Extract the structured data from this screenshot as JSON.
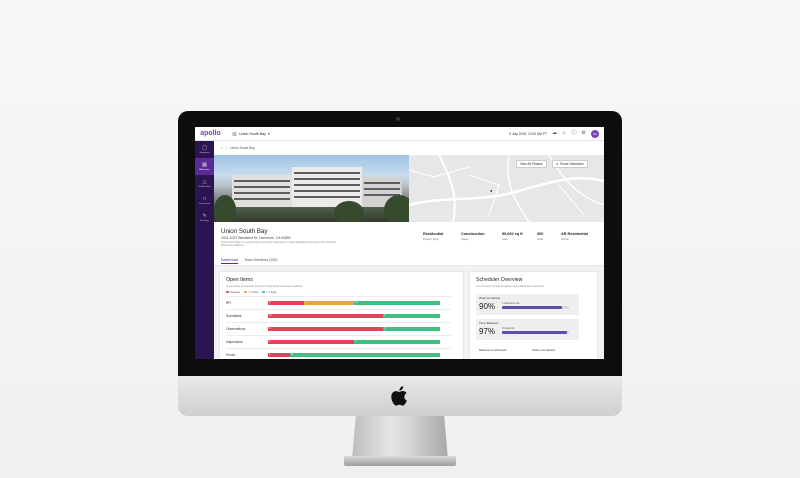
{
  "app": {
    "brand": "apollo",
    "project_selector": "Union South Bay",
    "date": "9 July 2019, 10:00 AM PT",
    "user_initials": "AF"
  },
  "sidebar": {
    "items": [
      {
        "label": "Budgeting",
        "icon": "dollar-icon",
        "active": false
      },
      {
        "label": "Milestones",
        "icon": "calendar-icon",
        "active": true
      },
      {
        "label": "Collaboration",
        "icon": "people-icon",
        "active": false
      },
      {
        "label": "Documents",
        "icon": "folder-icon",
        "active": false
      },
      {
        "label": "Drawings",
        "icon": "pencil-icon",
        "active": false
      }
    ]
  },
  "breadcrumb": {
    "current": "Union South Bay"
  },
  "map": {
    "view_phases": "View All Phases",
    "directions": "Share Directions"
  },
  "project": {
    "name": "Union South Bay",
    "address": "1001-1097 Westwind St, Livermore, CA 94550",
    "description": "Union South Bay is a project that is currently underway to create affordable housing for the Southern District of California."
  },
  "stats": [
    {
      "value": "Residential",
      "label": "Project Type"
    },
    {
      "value": "Construction",
      "label": "Stage"
    },
    {
      "value": "50,000 sq ft",
      "label": "Area"
    },
    {
      "value": "300",
      "label": "Units"
    },
    {
      "value": "AR Residential",
      "label": "Owner"
    }
  ],
  "tabs": [
    {
      "label": "Dashboard",
      "active": true
    },
    {
      "label": "Team Members (150)",
      "active": false
    }
  ],
  "open_items": {
    "title": "Open Items",
    "subtitle": "A summary of overdue and upcoming actions across modules",
    "legend": [
      {
        "label": "Overdue",
        "color": "#e0445a"
      },
      {
        "label": "< 7 days",
        "color": "#e8a04a"
      },
      {
        "label": "> 7 days",
        "color": "#3fbf83"
      }
    ],
    "rows": [
      {
        "label": "RFI",
        "segments": [
          {
            "value": 5,
            "color": "#e0445a"
          },
          {
            "value": 7,
            "color": "#e8a04a"
          },
          {
            "value": 12,
            "color": "#3fbf83"
          }
        ]
      },
      {
        "label": "Submittals",
        "segments": [
          {
            "value": 16,
            "color": "#e0445a"
          },
          {
            "value": 8,
            "color": "#3fbf83"
          }
        ]
      },
      {
        "label": "Observations",
        "segments": [
          {
            "value": 8,
            "color": "#e0445a"
          },
          {
            "value": 4,
            "color": "#3fbf83"
          }
        ]
      },
      {
        "label": "Inspections",
        "segments": [
          {
            "value": 4,
            "color": "#e0445a"
          },
          {
            "value": 4,
            "color": "#3fbf83"
          }
        ]
      },
      {
        "label": "Punch",
        "segments": [
          {
            "value": 2,
            "color": "#e0445a"
          },
          {
            "value": 14,
            "color": "#3fbf83"
          }
        ]
      }
    ]
  },
  "scheduler": {
    "title": "Scheduler Overview",
    "subtitle": "An overview of task progress and milestones achieved",
    "work_complete": {
      "label": "Work Complete",
      "percent": "90%",
      "note": "2 milestones left",
      "fraction": 0.9
    },
    "time_elapsed": {
      "label": "Time Elapsed",
      "percent": "97%",
      "note": "30 days left",
      "fraction": 0.97
    },
    "milestones_label": "Milestones Achieved",
    "tasks_label": "Tasks Completed"
  }
}
